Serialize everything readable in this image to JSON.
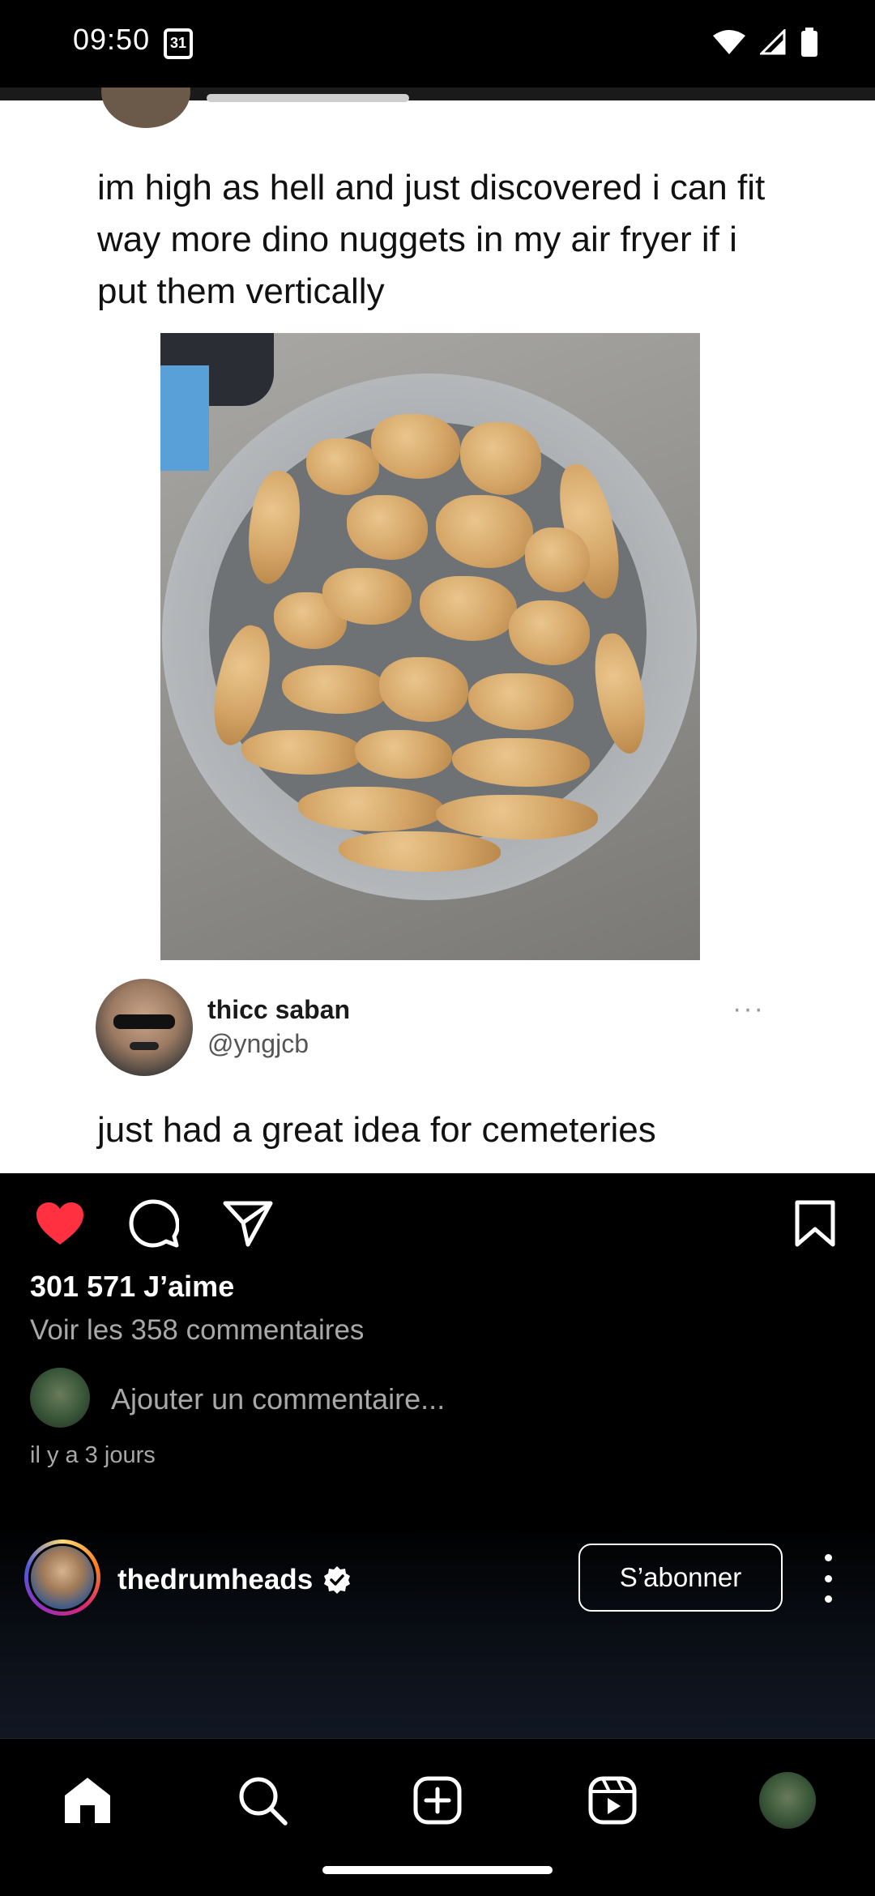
{
  "status_bar": {
    "time": "09:50",
    "calendar_day": "31",
    "icons": [
      "wifi-icon",
      "signal-icon",
      "battery-icon"
    ]
  },
  "post": {
    "tweet1_text": "im high as hell and just discovered i can fit way more dino nuggets in my air fryer if i put them vertically",
    "tweet2_author_name": "thicc saban",
    "tweet2_author_handle": "@yngjcb",
    "tweet2_more": "···",
    "tweet2_text": "just had a great idea for cemeteries"
  },
  "actions": {
    "like_icon": "heart-filled-icon",
    "like_color": "#ff3040",
    "comment_icon": "comment-icon",
    "share_icon": "send-icon",
    "save_icon": "bookmark-icon"
  },
  "engagement": {
    "likes": "301 571 J’aime",
    "view_comments": "Voir les 358 commentaires",
    "comment_placeholder": "Ajouter un commentaire...",
    "timestamp": "il y a 3 jours"
  },
  "account": {
    "username": "thedrumheads",
    "verified": true,
    "follow_label": "S’abonner"
  },
  "bottom_nav": {
    "items": [
      "home-icon",
      "search-icon",
      "create-icon",
      "reels-icon",
      "profile-avatar"
    ]
  }
}
